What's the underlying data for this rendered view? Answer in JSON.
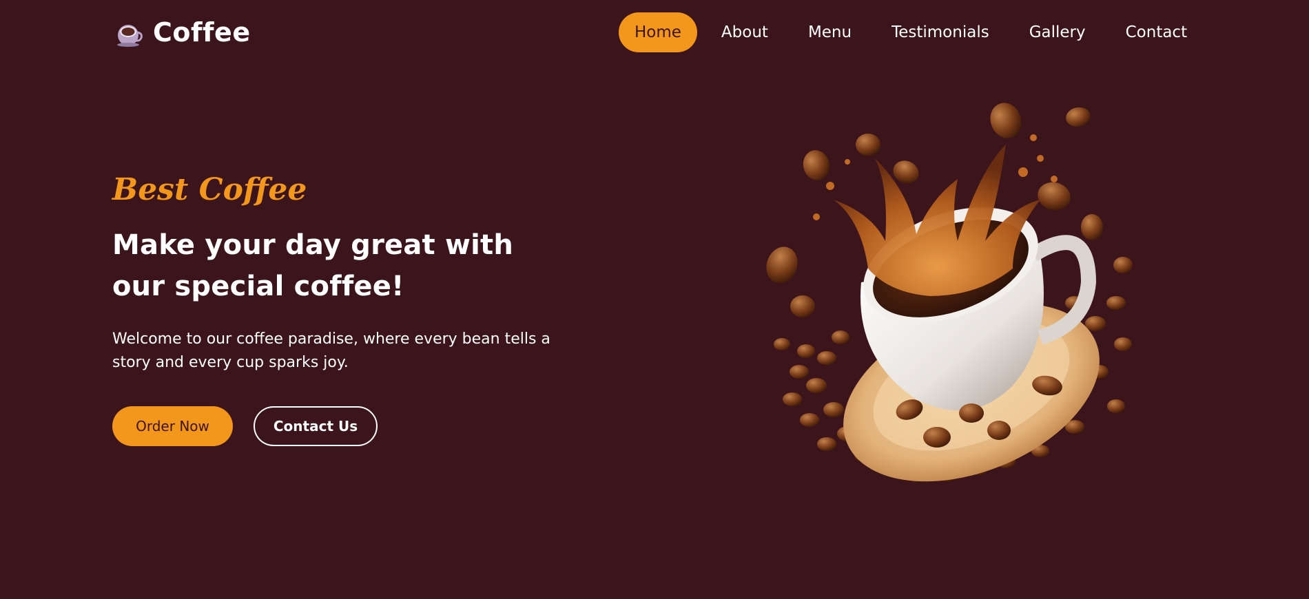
{
  "header": {
    "logo_text": "Coffee",
    "nav": [
      {
        "label": "Home",
        "active": true
      },
      {
        "label": "About",
        "active": false
      },
      {
        "label": "Menu",
        "active": false
      },
      {
        "label": "Testimonials",
        "active": false
      },
      {
        "label": "Gallery",
        "active": false
      },
      {
        "label": "Contact",
        "active": false
      }
    ]
  },
  "hero": {
    "subtitle": "Best Coffee",
    "title": "Make your day great with our special coffee!",
    "description": "Welcome to our coffee paradise, where every bean tells a story and every cup sparks joy.",
    "order_button": "Order Now",
    "contact_button": "Contact Us",
    "image_icon": "coffee-cup-splash-image"
  },
  "colors": {
    "background": "#3b141c",
    "accent": "#f3961c",
    "text": "#ffffff"
  }
}
